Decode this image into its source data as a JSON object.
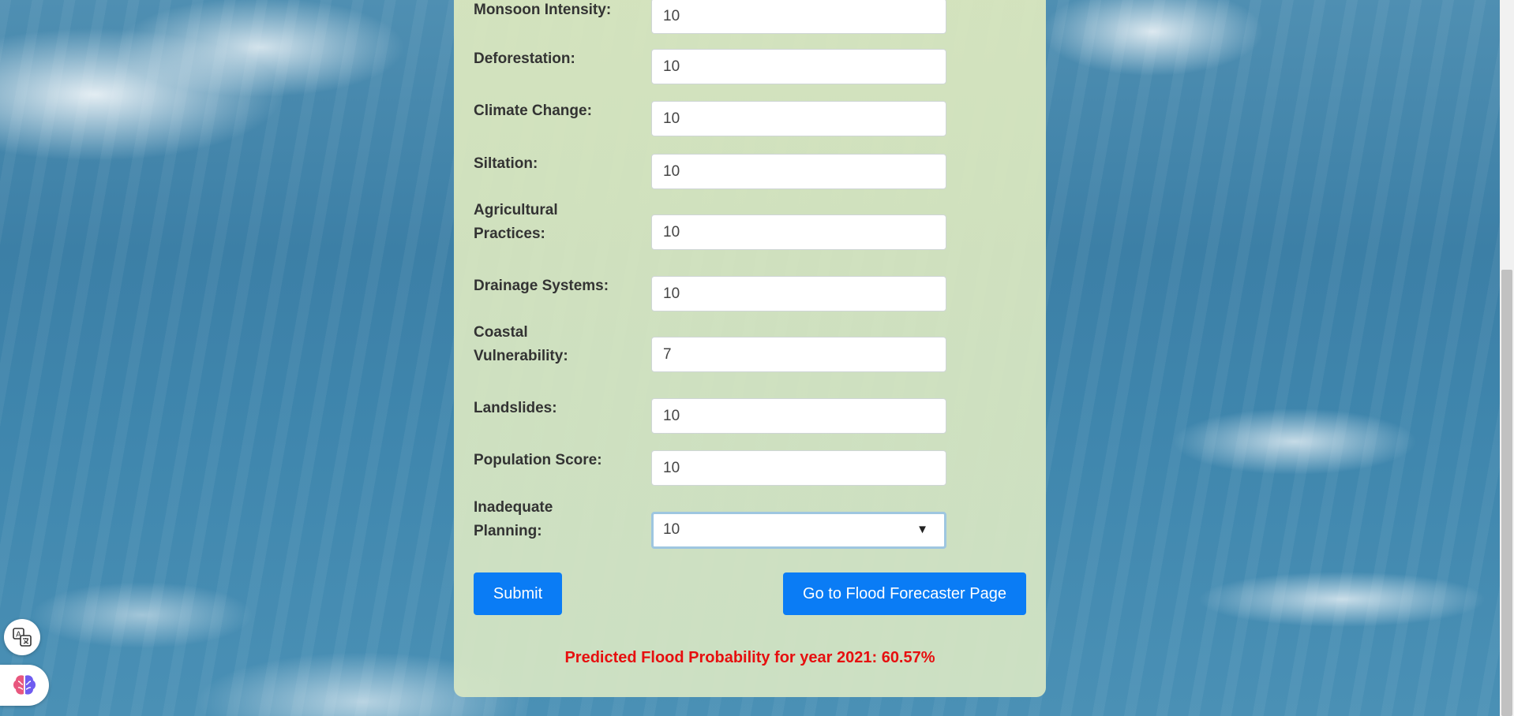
{
  "form": {
    "fields": [
      {
        "label": "Monsoon Intensity:",
        "value": "10"
      },
      {
        "label": "Deforestation:",
        "value": "10"
      },
      {
        "label": "Climate Change:",
        "value": "10"
      },
      {
        "label": "Siltation:",
        "value": "10"
      },
      {
        "label": "Agricultural Practices:",
        "value": "10"
      },
      {
        "label": "Drainage Systems:",
        "value": "10"
      },
      {
        "label": "Coastal Vulnerability:",
        "value": "7"
      },
      {
        "label": "Landslides:",
        "value": "10"
      },
      {
        "label": "Population Score:",
        "value": "10"
      }
    ],
    "select": {
      "label": "Inadequate Planning:",
      "value": "10"
    },
    "submit_label": "Submit",
    "forecaster_label": "Go to Flood Forecaster Page",
    "result_text": "Predicted Flood Probability for year 2021: 60.57%"
  },
  "colors": {
    "button": "#0a7cf5",
    "result": "#e60f0f",
    "panel": "#dde9be"
  },
  "icons": {
    "translate": "translate-icon",
    "brain": "brain-icon",
    "dropdown": "dropdown-arrow-icon"
  }
}
